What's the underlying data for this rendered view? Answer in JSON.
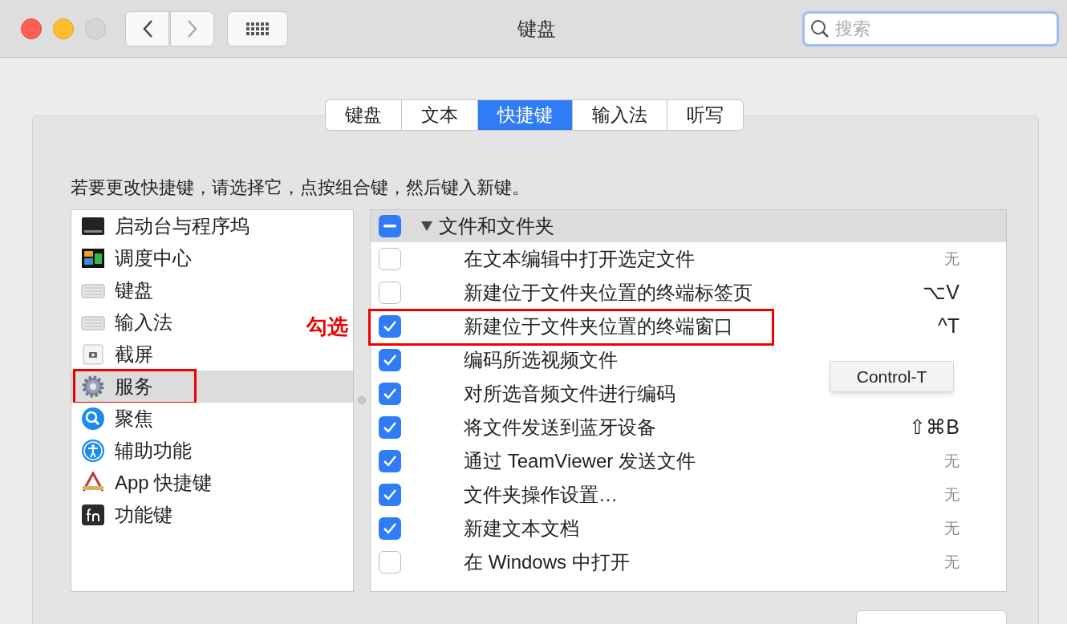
{
  "window": {
    "title": "键盘"
  },
  "search": {
    "placeholder": "搜索"
  },
  "tabs": [
    {
      "label": "键盘",
      "selected": false
    },
    {
      "label": "文本",
      "selected": false
    },
    {
      "label": "快捷键",
      "selected": true
    },
    {
      "label": "输入法",
      "selected": false
    },
    {
      "label": "听写",
      "selected": false
    }
  ],
  "instruction": "若要更改快捷键，请选择它，点按组合键，然后键入新键。",
  "categories": [
    {
      "label": "启动台与程序坞",
      "selected": false,
      "annotated": false
    },
    {
      "label": "调度中心",
      "selected": false,
      "annotated": false
    },
    {
      "label": "键盘",
      "selected": false,
      "annotated": false
    },
    {
      "label": "输入法",
      "selected": false,
      "annotated": false
    },
    {
      "label": "截屏",
      "selected": false,
      "annotated": false
    },
    {
      "label": "服务",
      "selected": true,
      "annotated": true
    },
    {
      "label": "聚焦",
      "selected": false,
      "annotated": false
    },
    {
      "label": "辅助功能",
      "selected": false,
      "annotated": false
    },
    {
      "label": "App 快捷键",
      "selected": false,
      "annotated": false
    },
    {
      "label": "功能键",
      "selected": false,
      "annotated": false
    }
  ],
  "services": {
    "group": {
      "label": "文件和文件夹",
      "expanded": true,
      "mixed": true
    },
    "rows": [
      {
        "label": "在文本编辑中打开选定文件",
        "checked": false,
        "shortcut": "无",
        "shortcut_set": false,
        "annotated": false
      },
      {
        "label": "新建位于文件夹位置的终端标签页",
        "checked": false,
        "shortcut": "⌥V",
        "shortcut_set": true,
        "annotated": false
      },
      {
        "label": "新建位于文件夹位置的终端窗口",
        "checked": true,
        "shortcut": "^T",
        "shortcut_set": true,
        "annotated": true
      },
      {
        "label": "编码所选视频文件",
        "checked": true,
        "annotated": false
      },
      {
        "label": "对所选音频文件进行编码",
        "checked": true,
        "annotated": false
      },
      {
        "label": "将文件发送到蓝牙设备",
        "checked": true,
        "shortcut": "⇧⌘B",
        "shortcut_set": true,
        "annotated": false
      },
      {
        "label": "通过 TeamViewer 发送文件",
        "checked": true,
        "shortcut": "无",
        "shortcut_set": false,
        "annotated": false
      },
      {
        "label": "文件夹操作设置…",
        "checked": true,
        "shortcut": "无",
        "shortcut_set": false,
        "annotated": false
      },
      {
        "label": "新建文本文档",
        "checked": true,
        "shortcut": "无",
        "shortcut_set": false,
        "annotated": false
      },
      {
        "label": "在 Windows 中打开",
        "checked": false,
        "shortcut": "无",
        "shortcut_set": false,
        "annotated": false
      }
    ]
  },
  "tooltip": "Control-T",
  "annotation": "勾选"
}
